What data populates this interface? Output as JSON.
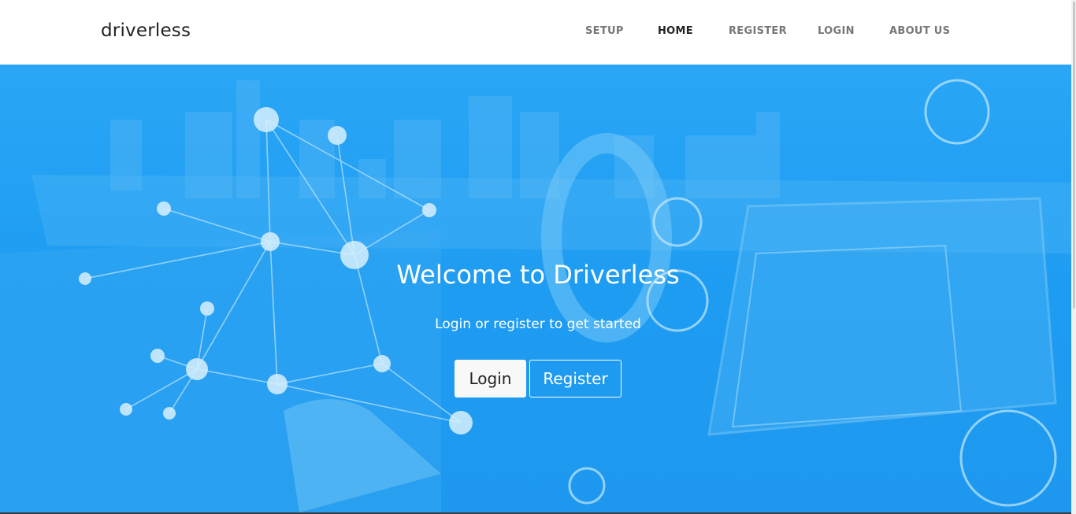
{
  "nav": {
    "brand": "driverless",
    "links": [
      {
        "label": "SETUP",
        "active": false
      },
      {
        "label": "HOME",
        "active": true
      },
      {
        "label": "REGISTER",
        "active": false
      },
      {
        "label": "LOGIN",
        "active": false
      },
      {
        "label": "ABOUT US",
        "active": false
      }
    ]
  },
  "hero": {
    "title": "Welcome to Driverless",
    "subtitle": "Login or register to get started",
    "login_label": "Login",
    "register_label": "Register"
  },
  "colors": {
    "hero_blue": "#1e9cf2",
    "nav_active": "#222222",
    "nav_inactive": "#777777"
  }
}
